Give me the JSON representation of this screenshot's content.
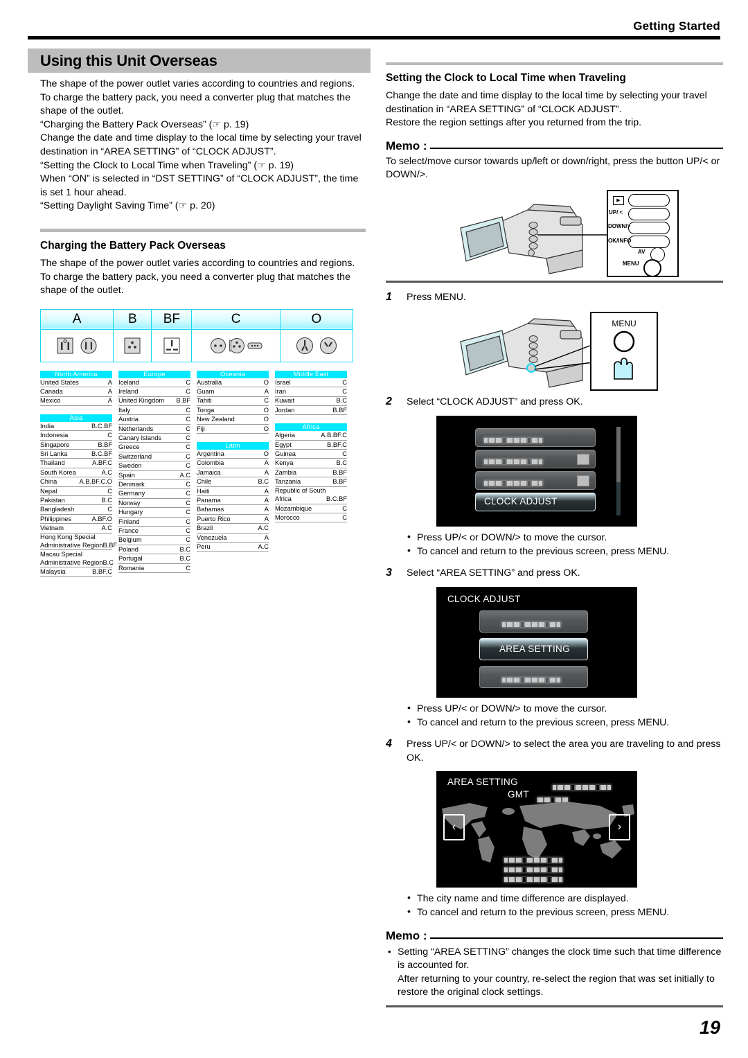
{
  "running_head": "Getting Started",
  "page_number": "19",
  "left": {
    "title": "Using this Unit Overseas",
    "intro_paragraphs": [
      "The shape of the power outlet varies according to countries and regions. To charge the battery pack, you need a converter plug that matches the shape of the outlet.",
      "“Charging the Battery Pack Overseas” (☞ p. 19)",
      "Change the date and time display to the local time by selecting your travel destination in “AREA SETTING” of “CLOCK ADJUST”.",
      "“Setting the Clock to Local Time when Traveling” (☞ p. 19)",
      "When “ON” is selected in “DST SETTING” of “CLOCK ADJUST”, the time is set 1 hour ahead.",
      "“Setting Daylight Saving Time” (☞ p. 20)"
    ],
    "section2_title": "Charging the Battery Pack Overseas",
    "section2_text": "The shape of the power outlet varies according to countries and regions. To charge the battery pack, you need a converter plug that matches the shape of the outlet.",
    "plug_types": [
      "A",
      "B",
      "BF",
      "C",
      "O"
    ],
    "country_columns": [
      {
        "groups": [
          {
            "region": "North America",
            "rows": [
              {
                "name": "United States",
                "code": "A"
              },
              {
                "name": "Canada",
                "code": "A"
              },
              {
                "name": "Mexico",
                "code": "A"
              }
            ]
          },
          {
            "region": "Asia",
            "rows": [
              {
                "name": "India",
                "code": "B.C.BF"
              },
              {
                "name": "Indonesia",
                "code": "C"
              },
              {
                "name": "Singapore",
                "code": "B.BF"
              },
              {
                "name": "Sri Lanka",
                "code": "B.C.BF"
              },
              {
                "name": "Thailand",
                "code": "A.BF.C"
              },
              {
                "name": "South Korea",
                "code": "A.C"
              },
              {
                "name": "China",
                "code": "A.B.BF.C.O"
              },
              {
                "name": "Nepal",
                "code": "C"
              },
              {
                "name": "Pakistan",
                "code": "B.C"
              },
              {
                "name": "Bangladesh",
                "code": "C"
              },
              {
                "name": "Philippines",
                "code": "A.BF.O"
              },
              {
                "name": "Vietnam",
                "code": "A.C"
              },
              {
                "name": "Hong Kong Special",
                "name2": "Administrative Region",
                "code": "B.BF"
              },
              {
                "name": "Macau Special",
                "name2": "Administrative Region",
                "code": "B.C"
              },
              {
                "name": "Malaysia",
                "code": "B.BF.C"
              }
            ]
          }
        ]
      },
      {
        "groups": [
          {
            "region": "Europe",
            "rows": [
              {
                "name": "Iceland",
                "code": "C"
              },
              {
                "name": "Ireland",
                "code": "C"
              },
              {
                "name": "United Kingdom",
                "code": "B.BF"
              },
              {
                "name": "Italy",
                "code": "C"
              },
              {
                "name": "Austria",
                "code": "C"
              },
              {
                "name": "Netherlands",
                "code": "C"
              },
              {
                "name": "Canary Islands",
                "code": "C"
              },
              {
                "name": "Greece",
                "code": "C"
              },
              {
                "name": "Switzerland",
                "code": "C"
              },
              {
                "name": "Sweden",
                "code": "C"
              },
              {
                "name": "Spain",
                "code": "A.C"
              },
              {
                "name": "Denmark",
                "code": "C"
              },
              {
                "name": "Germany",
                "code": "C"
              },
              {
                "name": "Norway",
                "code": "C"
              },
              {
                "name": "Hungary",
                "code": "C"
              },
              {
                "name": "Finland",
                "code": "C"
              },
              {
                "name": "France",
                "code": "C"
              },
              {
                "name": "Belgium",
                "code": "C"
              },
              {
                "name": "Poland",
                "code": "B.C"
              },
              {
                "name": "Portugal",
                "code": "B.C"
              },
              {
                "name": "Romania",
                "code": "C"
              }
            ]
          }
        ]
      },
      {
        "groups": [
          {
            "region": "Oceania",
            "rows": [
              {
                "name": "Australia",
                "code": "O"
              },
              {
                "name": "Guam",
                "code": "A"
              },
              {
                "name": "Tahiti",
                "code": "C"
              },
              {
                "name": "Tonga",
                "code": "O"
              },
              {
                "name": "New Zealand",
                "code": "O"
              },
              {
                "name": "Fiji",
                "code": "O"
              }
            ]
          },
          {
            "region": "Latin",
            "rows": [
              {
                "name": "Argentina",
                "code": "O"
              },
              {
                "name": "Colombia",
                "code": "A"
              },
              {
                "name": "Jamaica",
                "code": "A"
              },
              {
                "name": "Chile",
                "code": "B.C"
              },
              {
                "name": "Haiti",
                "code": "A"
              },
              {
                "name": "Panama",
                "code": "A"
              },
              {
                "name": "Bahamas",
                "code": "A"
              },
              {
                "name": "Puerto Rico",
                "code": "A"
              },
              {
                "name": "Brazil",
                "code": "A.C"
              },
              {
                "name": "Venezuela",
                "code": "A"
              },
              {
                "name": "Peru",
                "code": "A.C"
              }
            ]
          }
        ]
      },
      {
        "groups": [
          {
            "region": "Middle East",
            "rows": [
              {
                "name": "Israel",
                "code": "C"
              },
              {
                "name": "Iran",
                "code": "C"
              },
              {
                "name": "Kuwait",
                "code": "B.C"
              },
              {
                "name": "Jordan",
                "code": "B.BF"
              }
            ]
          },
          {
            "region": "Africa",
            "rows": [
              {
                "name": "Algeria",
                "code": "A.B.BF.C"
              },
              {
                "name": "Egypt",
                "code": "B.BF.C"
              },
              {
                "name": "Guinea",
                "code": "C"
              },
              {
                "name": "Kenya",
                "code": "B.C"
              },
              {
                "name": "Zambia",
                "code": "B.BF"
              },
              {
                "name": "Tanzania",
                "code": "B.BF"
              },
              {
                "name": "Republic of South",
                "name2": "Africa",
                "code": "B.C.BF"
              },
              {
                "name": "Mozambique",
                "code": "C"
              },
              {
                "name": "Morocco",
                "code": "C"
              }
            ]
          }
        ]
      }
    ]
  },
  "right": {
    "section_title": "Setting the Clock to Local Time when Traveling",
    "intro1": "Change the date and time display to the local time by selecting your travel destination in “AREA SETTING” of “CLOCK ADJUST”.",
    "intro2": "Restore the region settings after you returned from the trip.",
    "memo1_label": "Memo :",
    "memo1_text": "To select/move cursor towards up/left or down/right, press the button UP/< or DOWN/>.",
    "button_callout": {
      "play": "▶",
      "up": "UP/ <",
      "down": "DOWN/>",
      "ok": "OK/INFO",
      "av": "AV",
      "menu": "MENU"
    },
    "menu_callout_label": "MENU",
    "steps": [
      {
        "num": "1",
        "text": "Press MENU."
      },
      {
        "num": "2",
        "text": "Select “CLOCK ADJUST” and press OK."
      },
      {
        "num": "3",
        "text": "Select “AREA SETTING” and press OK."
      },
      {
        "num": "4",
        "text": "Press UP/< or DOWN/> to select the area you are traveling to and press OK."
      }
    ],
    "bullets_after_2": [
      "Press UP/< or DOWN/> to move the cursor.",
      "To cancel and return to the previous screen, press MENU."
    ],
    "bullets_after_3": [
      "Press UP/< or DOWN/> to move the cursor.",
      "To cancel and return to the previous screen, press MENU."
    ],
    "bullets_after_4": [
      "The city name and time difference are displayed.",
      "To cancel and return to the previous screen, press MENU."
    ],
    "lcd_clock_adjust": {
      "selected_item": "CLOCK ADJUST"
    },
    "lcd_area_setting": {
      "title": "CLOCK ADJUST",
      "selected_item": "AREA SETTING"
    },
    "lcd_map": {
      "title": "AREA SETTING",
      "gmt_label": "GMT",
      "left_arrow": "‹",
      "right_arrow": "›"
    },
    "memo2_label": "Memo :",
    "memo2_items": [
      "Setting “AREA SETTING” changes the clock time such that time difference is accounted for.",
      "After returning to your country, re-select the region that was set initially to restore the original clock settings."
    ]
  },
  "colors": {
    "title_band": "#bdbdbd",
    "region_header": "#00e8ff",
    "plug_border": "#16d7f2"
  }
}
